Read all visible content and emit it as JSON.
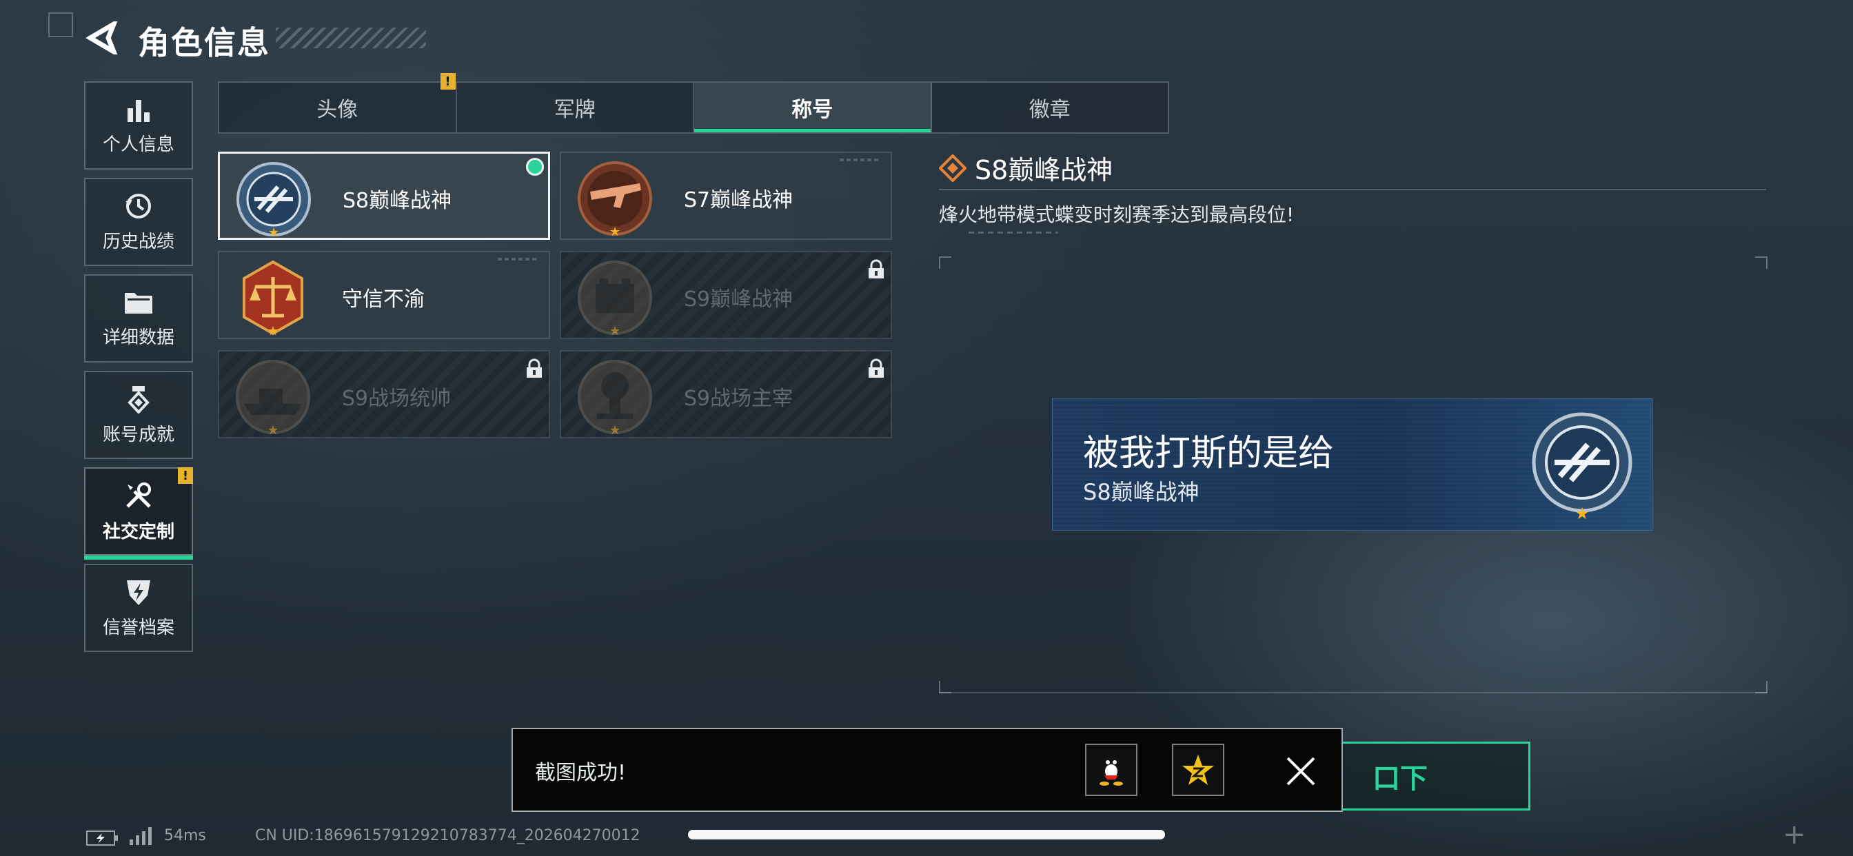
{
  "header": {
    "title": "角色信息"
  },
  "sidebar": {
    "items": [
      {
        "label": "个人信息",
        "icon": "bar-chart-icon"
      },
      {
        "label": "历史战绩",
        "icon": "history-clock-icon"
      },
      {
        "label": "详细数据",
        "icon": "folder-icon"
      },
      {
        "label": "账号成就",
        "icon": "achievement-medal-icon"
      },
      {
        "label": "社交定制",
        "icon": "tools-wrench-icon",
        "active": true,
        "warning": "!"
      },
      {
        "label": "信誉档案",
        "icon": "shield-bolt-icon"
      }
    ]
  },
  "tabs": [
    {
      "label": "头像",
      "warning": "!"
    },
    {
      "label": "军牌"
    },
    {
      "label": "称号",
      "active": true
    },
    {
      "label": "徽章"
    }
  ],
  "cards": [
    {
      "name": "S8巅峰战神",
      "selected": true,
      "locked": false
    },
    {
      "name": "S7巅峰战神",
      "selected": false,
      "locked": false
    },
    {
      "name": "守信不渝",
      "selected": false,
      "locked": false
    },
    {
      "name": "S9巅峰战神",
      "selected": false,
      "locked": true
    },
    {
      "name": "S9战场统帅",
      "selected": false,
      "locked": true
    },
    {
      "name": "S9战场主宰",
      "selected": false,
      "locked": true
    }
  ],
  "detail": {
    "title": "S8巅峰战神",
    "description": "烽火地带模式蝶变时刻赛季达到最高段位!"
  },
  "nameplate": {
    "player_name": "被我打斯的是给",
    "title": "S8巅峰战神"
  },
  "action_button": {
    "label": "口下"
  },
  "toast": {
    "message": "截图成功!",
    "share_qq_icon": "qq-penguin-icon",
    "share_qzone_icon": "qzone-star-icon"
  },
  "status": {
    "ping": "54ms",
    "uid": "CN UID:18696157912921078​3774_202604270012"
  },
  "colors": {
    "accent_green": "#2ad39a",
    "warning_yellow": "#e7b32a",
    "nameplate_blue": "#1d3a5e"
  }
}
